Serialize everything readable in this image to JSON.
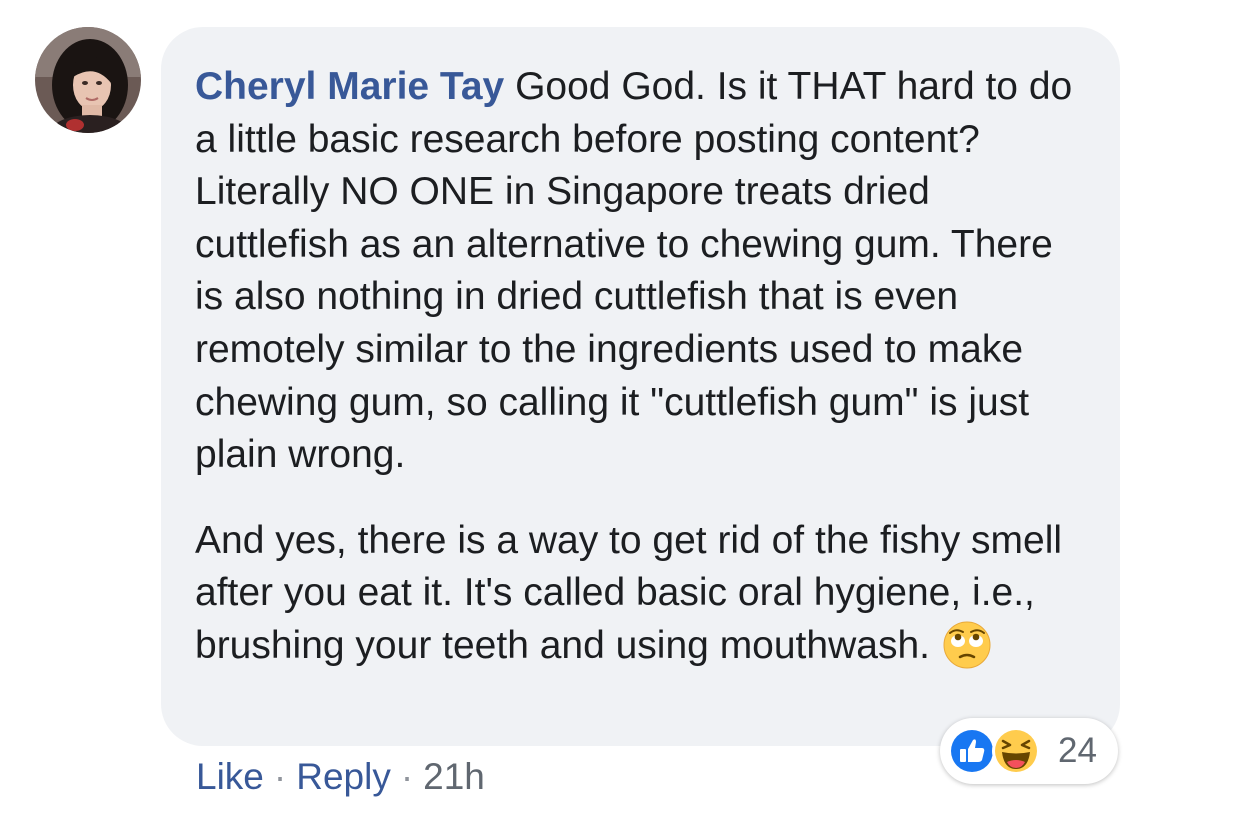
{
  "comment": {
    "author": "Cheryl Marie Tay",
    "paragraph1": "Good God. Is it THAT hard to do a little basic research before posting content? Literally NO ONE in Singapore treats dried cuttlefish as an alternative to chewing gum. There is also nothing in dried cuttlefish that is even remotely similar to the ingredients used to make chewing gum, so calling it \"cuttlefish gum\" is just plain wrong.",
    "paragraph2": "And yes, there is a way to get rid of the fishy smell after you eat it. It's called basic oral hygiene, i.e., brushing your teeth and using mouthwash.",
    "emoji": "eye-roll-emoji"
  },
  "actions": {
    "like_label": "Like",
    "separator": "·",
    "reply_label": "Reply",
    "timestamp": "21h"
  },
  "reactions": {
    "types": [
      "like-reaction-icon",
      "haha-reaction-icon"
    ],
    "count": "24"
  },
  "colors": {
    "author_link": "#385898",
    "bubble_bg": "#f0f2f5",
    "like_blue": "#1877f2",
    "meta_gray": "#606770"
  }
}
